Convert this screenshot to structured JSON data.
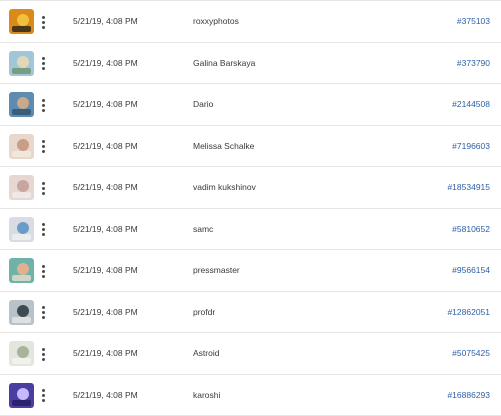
{
  "rows": [
    {
      "date": "5/21/19, 4:08 PM",
      "author": "roxxyphotos",
      "id": "#375103",
      "thumb": {
        "bg": "#d98a1a",
        "fg": "#f2c13c",
        "accent": "#1a1a1a"
      }
    },
    {
      "date": "5/21/19, 4:08 PM",
      "author": "Galina Barskaya",
      "id": "#373790",
      "thumb": {
        "bg": "#9fc7d9",
        "fg": "#e4d7b8",
        "accent": "#6b8f6a"
      }
    },
    {
      "date": "5/21/19, 4:08 PM",
      "author": "Dario",
      "id": "#2144508",
      "thumb": {
        "bg": "#5e8bb0",
        "fg": "#c9a98a",
        "accent": "#2e4f6b"
      }
    },
    {
      "date": "5/21/19, 4:08 PM",
      "author": "Melissa Schalke",
      "id": "#7196603",
      "thumb": {
        "bg": "#e8d8cc",
        "fg": "#c99d86",
        "accent": "#f4ece6"
      }
    },
    {
      "date": "5/21/19, 4:08 PM",
      "author": "vadim kukshinov",
      "id": "#18534915",
      "thumb": {
        "bg": "#e6d7d3",
        "fg": "#c9a5a0",
        "accent": "#f3eeec"
      }
    },
    {
      "date": "5/21/19, 4:08 PM",
      "author": "samc",
      "id": "#5810652",
      "thumb": {
        "bg": "#d9dde3",
        "fg": "#6a9cc9",
        "accent": "#f2f2f2"
      }
    },
    {
      "date": "5/21/19, 4:08 PM",
      "author": "pressmaster",
      "id": "#9566154",
      "thumb": {
        "bg": "#6fb3a8",
        "fg": "#e2b08f",
        "accent": "#f0e0d0"
      }
    },
    {
      "date": "5/21/19, 4:08 PM",
      "author": "profdr",
      "id": "#12862051",
      "thumb": {
        "bg": "#b9c2c8",
        "fg": "#3e4a52",
        "accent": "#e8eaec"
      }
    },
    {
      "date": "5/21/19, 4:08 PM",
      "author": "Astroid",
      "id": "#5075425",
      "thumb": {
        "bg": "#e3e6dc",
        "fg": "#a9b39a",
        "accent": "#f5f5f0"
      }
    },
    {
      "date": "5/21/19, 4:08 PM",
      "author": "karoshi",
      "id": "#16886293",
      "thumb": {
        "bg": "#4a3fa0",
        "fg": "#c7b9ff",
        "accent": "#1f1a5c"
      }
    }
  ]
}
